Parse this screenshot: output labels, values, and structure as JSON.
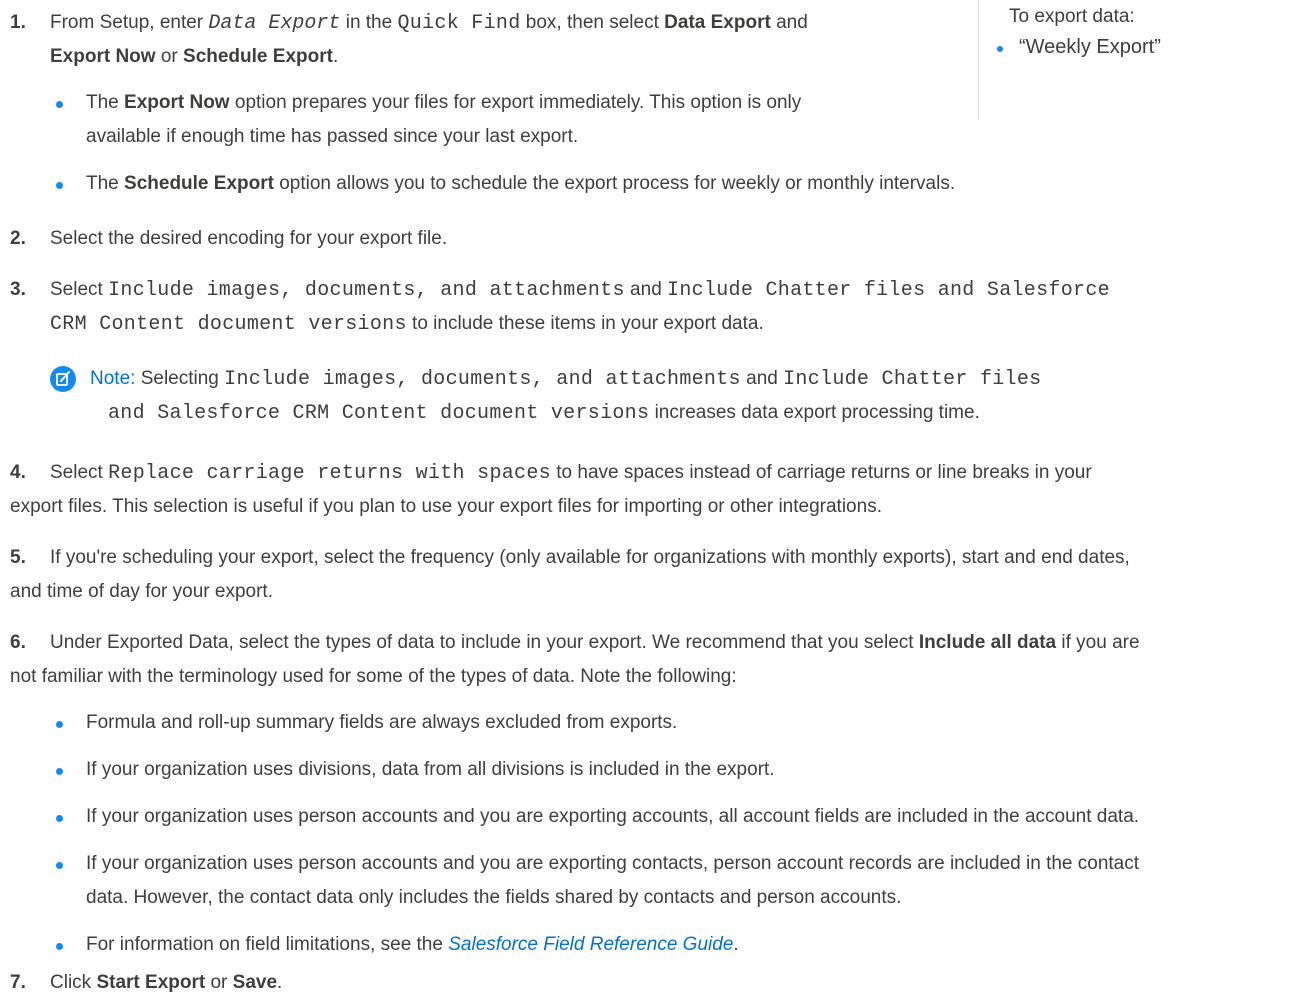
{
  "sidebar": {
    "heading": "To export data:",
    "permission": "“Weekly Export”"
  },
  "steps": {
    "s1": {
      "num": "1.",
      "t1": "From Setup, enter ",
      "quick_find_term": "Data Export",
      "t2": " in the ",
      "quick_find_box": "Quick Find",
      "t3": " box, then select ",
      "data_export": "Data Export",
      "t4": " and",
      "export_now": "Export Now",
      "or": " or ",
      "schedule_export": "Schedule Export",
      "period": ".",
      "b1_pre": "The ",
      "b1_bold": "Export Now",
      "b1_post": " option prepares your files for export immediately. This option is only",
      "b1_line2": "available if enough time has passed since your last export.",
      "b2_pre": "The ",
      "b2_bold": "Schedule Export",
      "b2_post": " option allows you to schedule the export process for weekly or monthly intervals."
    },
    "s2": {
      "num": "2.",
      "text": "Select the desired encoding for your export file."
    },
    "s3": {
      "num": "3.",
      "select": "Select ",
      "opt1": "Include images, documents, and attachments",
      "and": " and ",
      "opt2a": "Include Chatter files and Salesforce",
      "opt2b": "CRM Content document versions",
      "post": " to include these items in your export data."
    },
    "note": {
      "label": "Note:",
      "t1": " Selecting ",
      "opt1": "Include images, documents, and attachments",
      "and": " and ",
      "opt2a": "Include Chatter files",
      "opt2b": "and Salesforce CRM Content document versions",
      "post": " increases data export processing time."
    },
    "s4": {
      "num": "4.",
      "select": "Select ",
      "opt": "Replace carriage returns with spaces",
      "post": " to have spaces instead of carriage returns or line breaks in your",
      "line2": "export files. This selection is useful if you plan to use your export files for importing or other integrations."
    },
    "s5": {
      "num": "5.",
      "line1": "If you're scheduling your export, select the frequency (only available for organizations with monthly exports), start and end dates,",
      "line2": "and time of day for your export."
    },
    "s6": {
      "num": "6.",
      "line1_pre": "Under Exported Data, select the types of data to include in your export. We recommend that you select ",
      "line1_bold": "Include all data",
      "line1_post": " if you are",
      "line2": "not familiar with the terminology used for some of the types of data. Note the following:",
      "b1": "Formula and roll-up summary fields are always excluded from exports.",
      "b2": "If your organization uses divisions, data from all divisions is included in the export.",
      "b3": "If your organization uses person accounts and you are exporting accounts, all account fields are included in the account data.",
      "b4_line1": "If your organization uses person accounts and you are exporting contacts, person account records are included in the contact",
      "b4_line2": "data. However, the contact data only includes the fields shared by contacts and person accounts.",
      "b5_pre": "For information on field limitations, see the ",
      "b5_link": "Salesforce Field Reference Guide",
      "b5_post": "."
    },
    "s7": {
      "num": "7.",
      "pre": "Click ",
      "start_export": "Start Export",
      "or": " or ",
      "save": "Save",
      "period": "."
    }
  },
  "colors": {
    "accent": "#1589ee",
    "link": "#0070d2",
    "text": "#3e3e3c"
  }
}
